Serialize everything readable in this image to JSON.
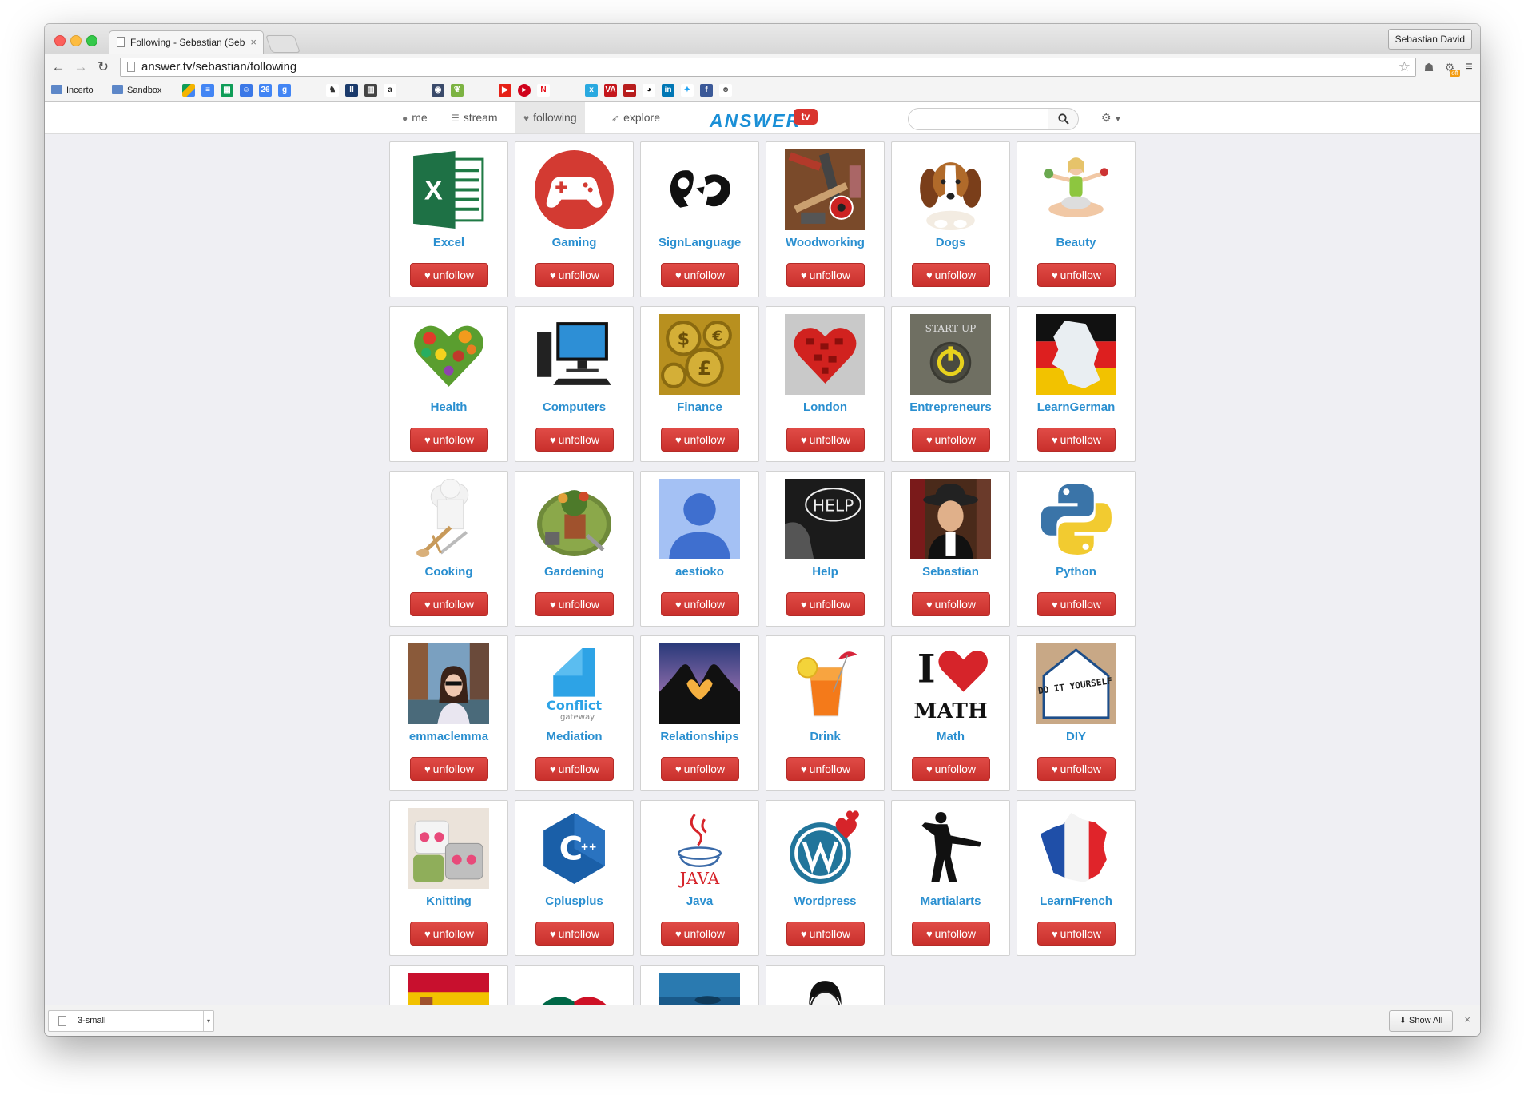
{
  "browser": {
    "tab_title": "Following - Sebastian (Seb",
    "tab_close": "×",
    "profile_name": "Sebastian David",
    "url": "answer.tv/sebastian/following",
    "ext_badge": "off"
  },
  "bookmarks": {
    "folders": [
      "Incerto",
      "Sandbox"
    ]
  },
  "site": {
    "nav": [
      {
        "label": "me",
        "icon": "user-icon"
      },
      {
        "label": "stream",
        "icon": "list-icon"
      },
      {
        "label": "following",
        "icon": "heart-icon"
      },
      {
        "label": "explore",
        "icon": "rocket-icon"
      }
    ],
    "logo_word": "ANSWER",
    "logo_tv": "tv",
    "search_placeholder": ""
  },
  "cards": [
    {
      "name": "Excel",
      "button": "unfollow"
    },
    {
      "name": "Gaming",
      "button": "unfollow"
    },
    {
      "name": "SignLanguage",
      "button": "unfollow"
    },
    {
      "name": "Woodworking",
      "button": "unfollow"
    },
    {
      "name": "Dogs",
      "button": "unfollow"
    },
    {
      "name": "Beauty",
      "button": "unfollow"
    },
    {
      "name": "Health",
      "button": "unfollow"
    },
    {
      "name": "Computers",
      "button": "unfollow"
    },
    {
      "name": "Finance",
      "button": "unfollow"
    },
    {
      "name": "London",
      "button": "unfollow"
    },
    {
      "name": "Entrepreneurs",
      "button": "unfollow"
    },
    {
      "name": "LearnGerman",
      "button": "unfollow"
    },
    {
      "name": "Cooking",
      "button": "unfollow"
    },
    {
      "name": "Gardening",
      "button": "unfollow"
    },
    {
      "name": "aestioko",
      "button": "unfollow"
    },
    {
      "name": "Help",
      "button": "unfollow"
    },
    {
      "name": "Sebastian",
      "button": "unfollow"
    },
    {
      "name": "Python",
      "button": "unfollow"
    },
    {
      "name": "emmaclemma",
      "button": "unfollow"
    },
    {
      "name": "Mediation",
      "button": "unfollow"
    },
    {
      "name": "Relationships",
      "button": "unfollow"
    },
    {
      "name": "Drink",
      "button": "unfollow"
    },
    {
      "name": "Math",
      "button": "unfollow"
    },
    {
      "name": "DIY",
      "button": "unfollow"
    },
    {
      "name": "Knitting",
      "button": "unfollow"
    },
    {
      "name": "Cplusplus",
      "button": "unfollow"
    },
    {
      "name": "Java",
      "button": "unfollow"
    },
    {
      "name": "Wordpress",
      "button": "unfollow"
    },
    {
      "name": "Martialarts",
      "button": "unfollow"
    },
    {
      "name": "LearnFrench",
      "button": "unfollow"
    }
  ],
  "thumb_text": {
    "excel_letter": "X",
    "entrepreneurs": "START UP",
    "help": "HELP",
    "mediation_1": "Conflict",
    "mediation_2": "gateway",
    "math_1": "I",
    "math_2": "MATH",
    "diy": "DO IT YOURSELF",
    "java": "JAVA",
    "cpp": "C",
    "cpp_plus": "++"
  },
  "downloads": {
    "file_name": "3-small",
    "show_all": "Show All",
    "close": "×"
  }
}
